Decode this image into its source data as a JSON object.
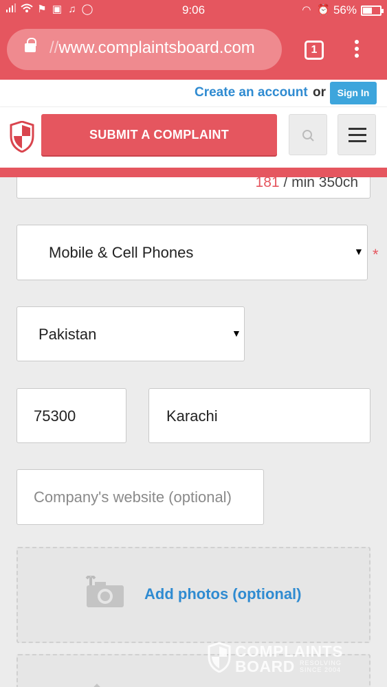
{
  "status_bar": {
    "time": "9:06",
    "battery": "56%",
    "battery_level": 0.56
  },
  "browser": {
    "url_prefix": "//",
    "url": "www.complaintsboard.com",
    "tab_count": "1"
  },
  "account": {
    "create_label": "Create an account",
    "or_label": "or",
    "signin_label": "Sign In"
  },
  "header": {
    "submit_label": "SUBMIT A COMPLAINT"
  },
  "form": {
    "counter_value": "181",
    "counter_rest": "/ min 350ch",
    "category": "Mobile & Cell Phones",
    "required_mark": "*",
    "country": "Pakistan",
    "zip": "75300",
    "city": "Karachi",
    "website_placeholder": "Company's website (optional)",
    "add_photos_label": "Add photos (optional)"
  },
  "watermark": {
    "line1": "COMPLAINTS",
    "line2": "BOARD",
    "tagline1": "RESOLVING",
    "tagline2": "SINCE 2004"
  },
  "colors": {
    "brand_red": "#e5565f",
    "link_blue": "#2f8bd1",
    "signin_blue": "#3da5dc"
  }
}
